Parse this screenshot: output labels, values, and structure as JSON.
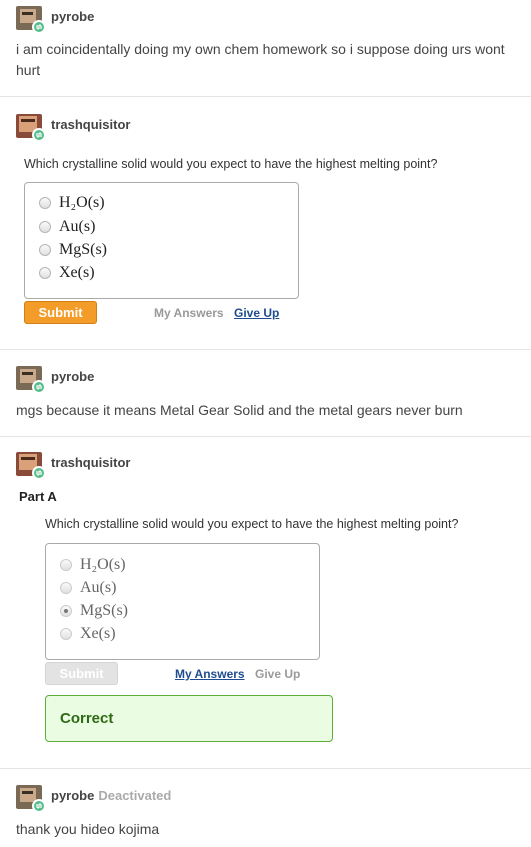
{
  "posts": [
    {
      "user": "pyrobe",
      "text": "i am coincidentally doing my own chem homework so i suppose doing urs wont",
      "text2": "hurt"
    },
    {
      "user": "trashquisitor"
    },
    {
      "user": "pyrobe",
      "text": "mgs because it means Metal Gear Solid and the metal gears never burn"
    },
    {
      "user": "trashquisitor"
    },
    {
      "user": "pyrobe",
      "status": "Deactivated",
      "text": "thank you hideo kojima"
    }
  ],
  "quiz1": {
    "question": "Which crystalline solid would you expect to have the highest melting point?",
    "choices": [
      "H₂O(s)",
      "Au(s)",
      "MgS(s)",
      "Xe(s)"
    ],
    "submit": "Submit",
    "my_answers": "My Answers",
    "give_up": "Give Up"
  },
  "quiz2": {
    "part": "Part A",
    "question": "Which crystalline solid would you expect to have the highest melting point?",
    "choices": [
      "H₂O(s)",
      "Au(s)",
      "MgS(s)",
      "Xe(s)"
    ],
    "selected_index": 2,
    "submit": "Submit",
    "my_answers": "My Answers",
    "give_up": "Give Up",
    "feedback": "Correct"
  },
  "colors": {
    "submit_orange": "#f39c2a",
    "correct_green": "#5cad3c",
    "link_blue": "#1f4c8f",
    "reblog_green": "#56bc8a"
  },
  "icons": {
    "avatar_pyrobe": "avatar",
    "avatar_trashquisitor": "avatar",
    "reblog_badge": "reblog-icon"
  }
}
